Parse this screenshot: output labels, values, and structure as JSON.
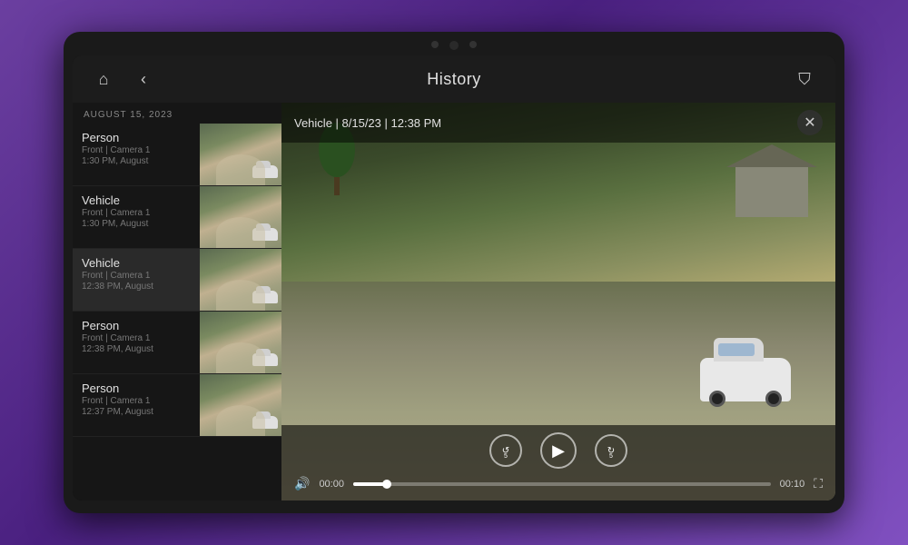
{
  "tablet": {
    "background_gradient": "linear-gradient(135deg, #6b3fa0, #8050c0)"
  },
  "header": {
    "title": "History",
    "home_icon": "⌂",
    "back_icon": "‹",
    "filter_icon": "⛉"
  },
  "history": {
    "date_label": "AUGUST 15, 2023",
    "items": [
      {
        "type": "Person",
        "location": "Front | Camera 1",
        "time": "1:30 PM, August"
      },
      {
        "type": "Vehicle",
        "location": "Front | Camera 1",
        "time": "1:30 PM, August"
      },
      {
        "type": "Vehicle",
        "location": "Front | Camera 1",
        "time": "12:38 PM, August"
      },
      {
        "type": "Person",
        "location": "Front | Camera 1",
        "time": "12:38 PM, August"
      },
      {
        "type": "Person",
        "location": "Front | Camera 1",
        "time": "12:37 PM, August"
      }
    ]
  },
  "video_player": {
    "title": "Vehicle | 8/15/23 | 12:38 PM",
    "close_label": "✕",
    "time_current": "00:00",
    "time_total": "00:10",
    "rewind_label": "5",
    "forward_label": "5",
    "play_icon": "▶",
    "volume_icon": "🔊",
    "fullscreen_icon": "⛶"
  }
}
